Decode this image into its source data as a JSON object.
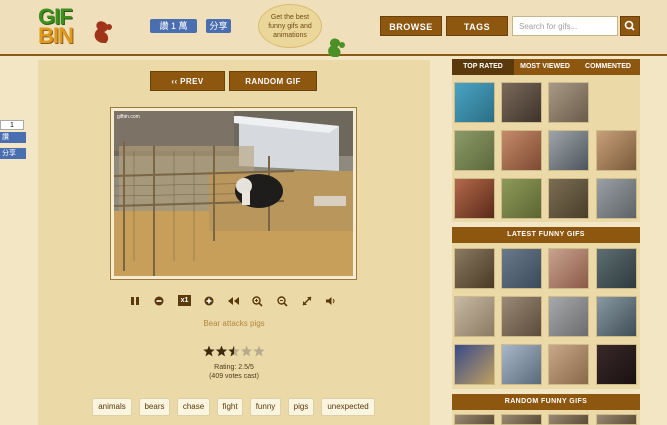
{
  "header": {
    "logo_line1": "GIF",
    "logo_line2": "BIN",
    "fb_like": "讚 1 萬",
    "fb_share": "分享",
    "tagline": "Get the best funny gifs and animations",
    "browse": "BROWSE",
    "tags": "TAGS",
    "search_placeholder": "Search for gifs..."
  },
  "side_social": {
    "count": "1",
    "like": "讚",
    "share": "分享"
  },
  "nav": {
    "prev": "‹‹ PREV",
    "random": "RANDOM GIF"
  },
  "gif": {
    "watermark": "gifbin.com",
    "title": "Bear attacks pigs",
    "rating_stars": 2.5,
    "rating_max": 5,
    "rating_text": "Rating: 2.5/5",
    "votes_text": "(409 votes cast)"
  },
  "controls": {
    "speed": "x1"
  },
  "tags": [
    "animals",
    "bears",
    "chase",
    "fight",
    "funny",
    "pigs",
    "unexpected"
  ],
  "sidebar": {
    "tabs": [
      "TOP RATED",
      "MOST VIEWED",
      "COMMENTED"
    ],
    "active_tab": "TOP RATED",
    "latest_title": "LATEST FUNNY GIFS",
    "random_title": "RANDOM FUNNY GIFS"
  },
  "colors": {
    "accent": "#8d5710",
    "background": "#f3e6c4",
    "panel": "#ecd9a8"
  }
}
